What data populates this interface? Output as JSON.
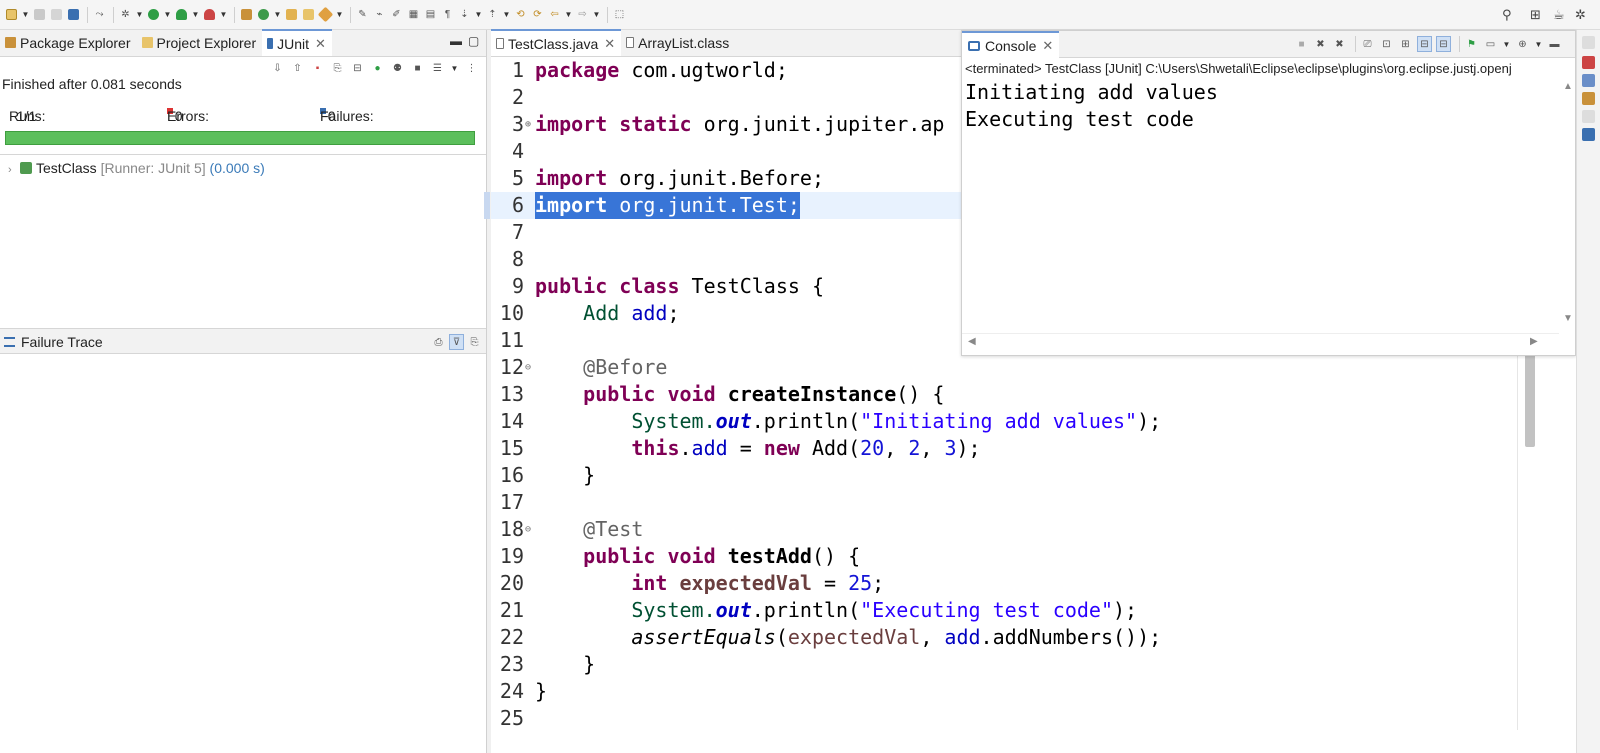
{
  "toolbar": {
    "icons": [
      "new-icon",
      "save-icon",
      "save-all-icon",
      "terminal-icon",
      "skip-icon",
      "debug-icon",
      "run-icon",
      "coverage-icon",
      "external-tools-icon",
      "new-package-icon",
      "new-class-icon",
      "open-type-icon",
      "open-task-icon",
      "search-icon",
      "pin-icon",
      "annotation-icon",
      "toggle-mark-icon",
      "show-whitespace-icon",
      "block-selection-icon",
      "prev-annotation-icon",
      "next-annotation-icon",
      "last-edit-icon",
      "back-icon",
      "forward-icon",
      "open-perspective-icon"
    ],
    "colors": {
      "run": "#2e9e45",
      "debug": "#6a8e3a",
      "accent": "#3a6fb0"
    }
  },
  "left_tabs": [
    {
      "label": "Package Explorer",
      "active": false
    },
    {
      "label": "Project Explorer",
      "active": false
    },
    {
      "label": "JUnit",
      "active": true
    }
  ],
  "junit": {
    "finished": "Finished after 0.081 seconds",
    "runs_label": "Runs:",
    "runs_value": "1/1",
    "errors_label": "Errors:",
    "errors_value": "0",
    "failures_label": "Failures:",
    "failures_value": "0",
    "progress_fraction": 1.0,
    "progress_color": "#5cbf5c",
    "tree_item_name": "TestClass",
    "tree_item_runner": "[Runner: JUnit 5]",
    "tree_item_time": "(0.000 s)"
  },
  "failure_trace": {
    "title": "Failure Trace"
  },
  "editor_tabs": [
    {
      "label": "TestClass.java",
      "active": true,
      "closable": true
    },
    {
      "label": "ArrayList.class",
      "active": false,
      "closable": false
    }
  ],
  "code": {
    "line_numbers": [
      "1",
      "2",
      "3",
      "4",
      "5",
      "6",
      "7",
      "8",
      "9",
      "10",
      "11",
      "12",
      "13",
      "14",
      "15",
      "16",
      "17",
      "18",
      "19",
      "20",
      "21",
      "22",
      "23",
      "24",
      "25"
    ],
    "current_line": 6,
    "l1_kw": "package",
    "l1_rest": " com.ugtworld;",
    "l3_kw1": "import",
    "l3_kw2": "static",
    "l3_rest": " org.junit.jupiter.ap",
    "l5_kw": "import",
    "l5_rest": " org.junit.Before;",
    "l6_kw": "import",
    "l6_rest": " org.junit.Test;",
    "l9_kw1": "public",
    "l9_kw2": "class",
    "l9_rest": " TestClass {",
    "l10_type": "Add",
    "l10_field": "add",
    "l10_end": ";",
    "l12_ann": "@Before",
    "l13_kw1": "public",
    "l13_kw2": "void",
    "l13_method": "createInstance",
    "l13_rest": "() {",
    "l14_sys": "System.",
    "l14_out": "out",
    "l14_mid": ".println(",
    "l14_str": "\"Initiating add values\"",
    "l14_end": ");",
    "l15_this": "this",
    "l15_dot": ".",
    "l15_field": "add",
    "l15_eq": " = ",
    "l15_new": "new",
    "l15_call": " Add(",
    "l15_n1": "20",
    "l15_c1": ", ",
    "l15_n2": "2",
    "l15_c2": ", ",
    "l15_n3": "3",
    "l15_end": ");",
    "l16_text": "}",
    "l18_ann": "@Test",
    "l19_kw1": "public",
    "l19_kw2": "void",
    "l19_method": "testAdd",
    "l19_rest": "() {",
    "l20_kw": "int",
    "l20_var": "expectedVal",
    "l20_eq": " = ",
    "l20_num": "25",
    "l20_end": ";",
    "l21_sys": "System.",
    "l21_out": "out",
    "l21_mid": ".println(",
    "l21_str": "\"Executing test code\"",
    "l21_end": ");",
    "l22_call": "assertEquals",
    "l22_open": "(",
    "l22_var": "expectedVal",
    "l22_comma": ", ",
    "l22_field": "add",
    "l22_rest": ".addNumbers());",
    "l23_text": "}",
    "l24_text": "}"
  },
  "console": {
    "tab_label": "Console",
    "terminated": "<terminated> TestClass [JUnit] C:\\Users\\Shwetali\\Eclipse\\eclipse\\plugins\\org.eclipse.justj.openj",
    "output_line1": "Initiating add values",
    "output_line2": "Executing test code"
  }
}
